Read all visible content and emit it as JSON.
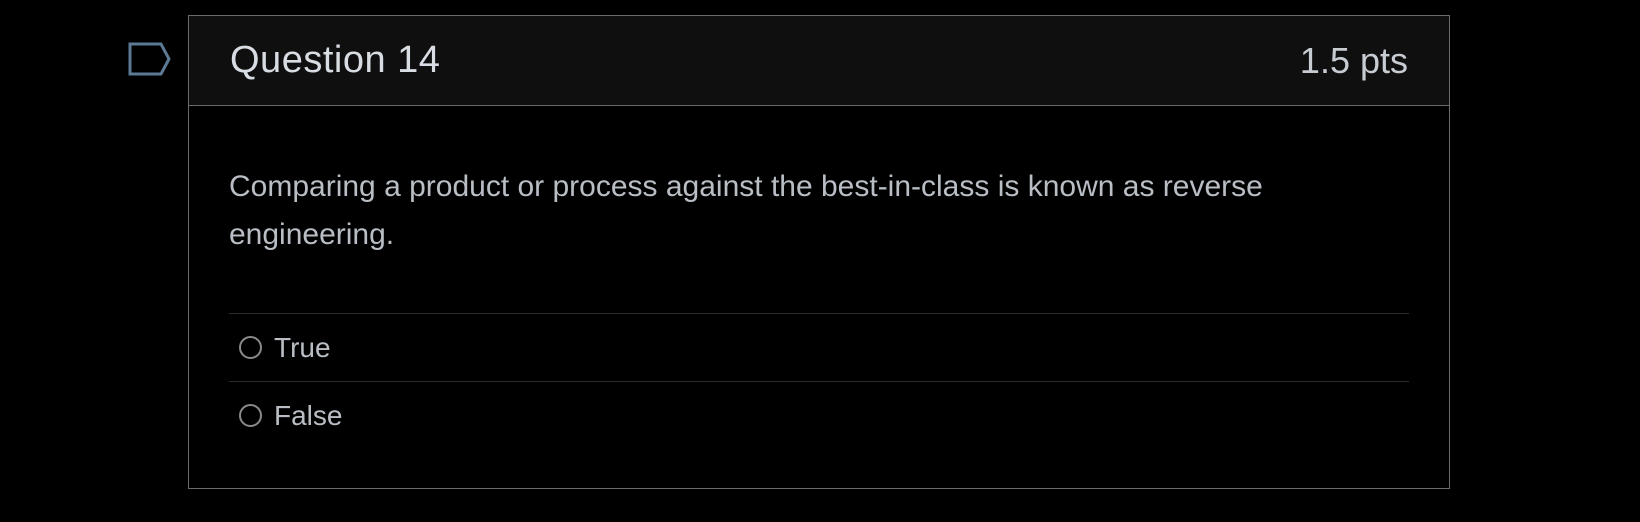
{
  "question": {
    "title": "Question 14",
    "points": "1.5 pts",
    "text": "Comparing a product or process against the best-in-class is known as reverse engineering.",
    "flag_icon": "bookmark-flag-icon",
    "answers": [
      {
        "label": "True",
        "selected": false
      },
      {
        "label": "False",
        "selected": false
      }
    ]
  },
  "colors": {
    "background": "#000000",
    "border": "#6b6b6b",
    "flag": "#5c7a94"
  }
}
